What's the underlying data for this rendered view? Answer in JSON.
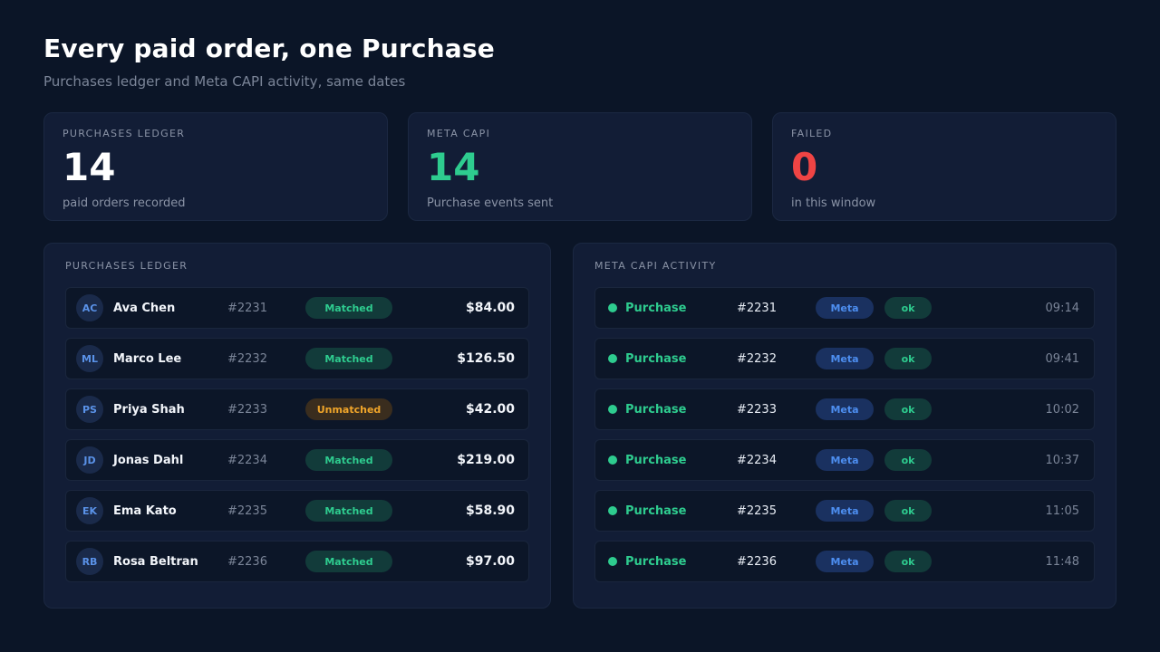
{
  "header": {
    "title": "Every paid order, one Purchase",
    "subtitle": "Purchases ledger and Meta CAPI activity, same dates"
  },
  "stats": [
    {
      "label": "PURCHASES LEDGER",
      "value": "14",
      "desc": "paid orders recorded",
      "color": "#ffffff"
    },
    {
      "label": "META CAPI",
      "value": "14",
      "desc": "Purchase events sent",
      "color": "#2ecc8f"
    },
    {
      "label": "FAILED",
      "value": "0",
      "desc": "in this window",
      "color": "#ef4444"
    }
  ],
  "ledger": {
    "title": "PURCHASES LEDGER",
    "rows": [
      {
        "initials": "AC",
        "name": "Ava Chen",
        "order": "#2231",
        "status": "Matched",
        "amount": "$84.00"
      },
      {
        "initials": "ML",
        "name": "Marco Lee",
        "order": "#2232",
        "status": "Matched",
        "amount": "$126.50"
      },
      {
        "initials": "PS",
        "name": "Priya Shah",
        "order": "#2233",
        "status": "Unmatched",
        "amount": "$42.00"
      },
      {
        "initials": "JD",
        "name": "Jonas Dahl",
        "order": "#2234",
        "status": "Matched",
        "amount": "$219.00"
      },
      {
        "initials": "EK",
        "name": "Ema Kato",
        "order": "#2235",
        "status": "Matched",
        "amount": "$58.90"
      },
      {
        "initials": "RB",
        "name": "Rosa Beltran",
        "order": "#2236",
        "status": "Matched",
        "amount": "$97.00"
      }
    ]
  },
  "capi": {
    "title": "META CAPI ACTIVITY",
    "rows": [
      {
        "event": "Purchase",
        "order": "#2231",
        "source": "Meta",
        "result": "ok",
        "time": "09:14"
      },
      {
        "event": "Purchase",
        "order": "#2232",
        "source": "Meta",
        "result": "ok",
        "time": "09:41"
      },
      {
        "event": "Purchase",
        "order": "#2233",
        "source": "Meta",
        "result": "ok",
        "time": "10:02"
      },
      {
        "event": "Purchase",
        "order": "#2234",
        "source": "Meta",
        "result": "ok",
        "time": "10:37"
      },
      {
        "event": "Purchase",
        "order": "#2235",
        "source": "Meta",
        "result": "ok",
        "time": "11:05"
      },
      {
        "event": "Purchase",
        "order": "#2236",
        "source": "Meta",
        "result": "ok",
        "time": "11:48"
      }
    ]
  },
  "colors": {
    "success": "#2ecc8f",
    "warning": "#f0a52a",
    "danger": "#ef4444",
    "meta": "#4d8ef0"
  }
}
